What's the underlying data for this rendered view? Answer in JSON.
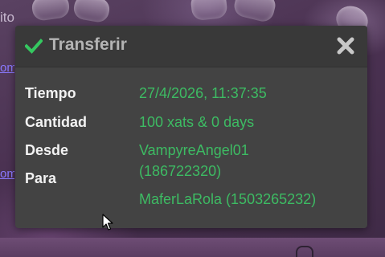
{
  "background": {
    "partial_text": "ito",
    "link_1": "om",
    "link_2": "om"
  },
  "dialog": {
    "title": "Transferir",
    "title_icon": "check-icon",
    "close_icon": "close-icon",
    "rows": [
      {
        "label": "Tiempo",
        "value": "27/4/2026, 11:37:35"
      },
      {
        "label": "Cantidad",
        "value": "100 xats & 0 days"
      },
      {
        "label": "Desde",
        "value_line_1": "VampyreAngel01",
        "value_line_2": "(186722320)"
      },
      {
        "label": "Para",
        "value": "MaferLaRola (1503265232)"
      }
    ]
  },
  "colors": {
    "value_green": "#3dbb63",
    "dialog_bg": "#434343",
    "header_bg": "#393939",
    "title_gray": "#b4b4b4",
    "check_green": "#35c860",
    "label_white": "#f2f2f2"
  }
}
